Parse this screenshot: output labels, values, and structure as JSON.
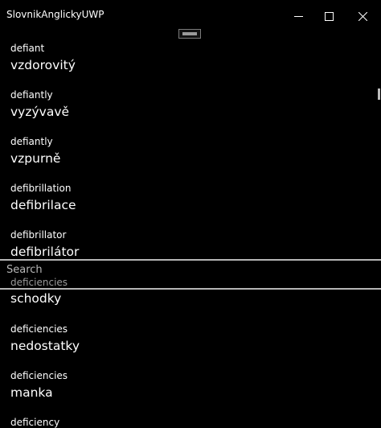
{
  "window": {
    "title": "SlovnikAnglickyUWP"
  },
  "list_top": [
    {
      "en": "defiant",
      "cz": "vzdorovitý"
    },
    {
      "en": "defiantly",
      "cz": "vyzývavě"
    },
    {
      "en": "defiantly",
      "cz": "vzpurně"
    },
    {
      "en": "defibrillation",
      "cz": "defibrilace"
    },
    {
      "en": "defibrillator",
      "cz": "defibrilátor"
    }
  ],
  "search": {
    "placeholder": "Search",
    "partial_word": "deficiencies"
  },
  "list_bottom": [
    {
      "cz": "schodky"
    },
    {
      "en": "deficiencies",
      "cz": "nedostatky"
    },
    {
      "en": "deficiencies",
      "cz": "manka"
    },
    {
      "en": "deficiency"
    }
  ],
  "icons": {
    "minimize": "minimize-icon",
    "maximize": "maximize-icon",
    "close": "close-icon"
  }
}
